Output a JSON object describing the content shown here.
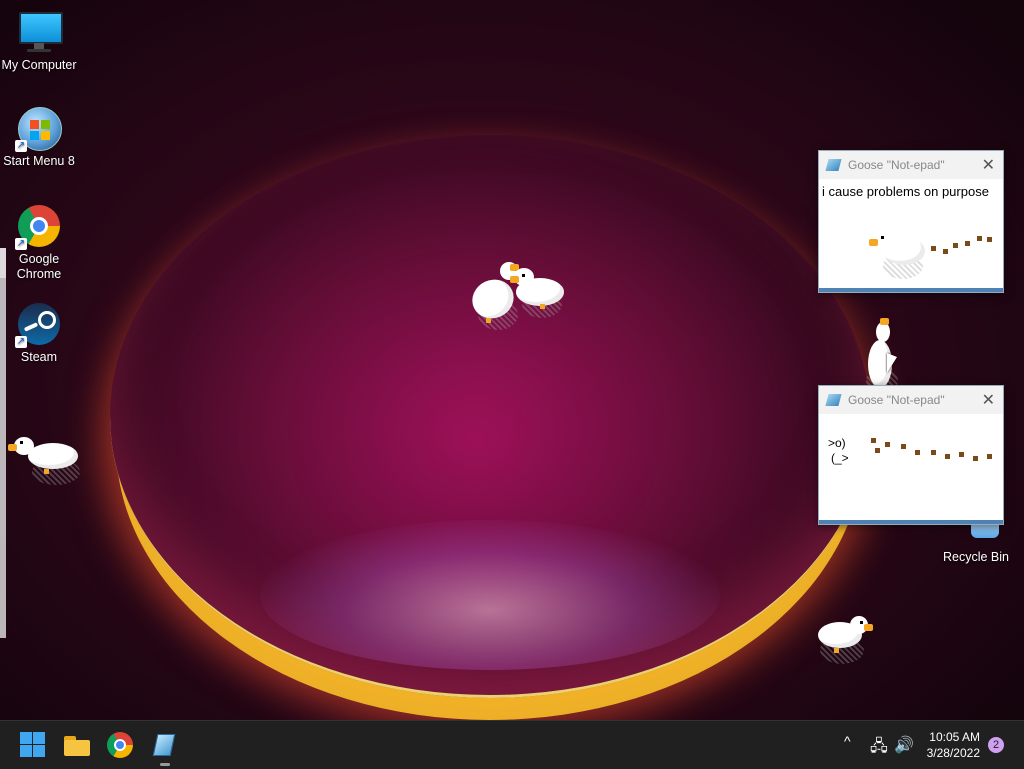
{
  "desktop": {
    "icons": [
      {
        "label": "My Computer"
      },
      {
        "label": "Start Menu 8"
      },
      {
        "label": "Google Chrome"
      },
      {
        "label": "Steam"
      },
      {
        "label": "Recycle Bin"
      }
    ]
  },
  "notepad_windows": [
    {
      "title": "Goose \"Not-epad\"",
      "text": "i cause problems on purpose"
    },
    {
      "title": "Goose \"Not-epad\"",
      "text_line1": ">o)",
      "text_line2": "(_>"
    }
  ],
  "close_glyph": "✕",
  "taskbar": {
    "apps": [
      "windows-start",
      "file-explorer",
      "google-chrome",
      "notepad"
    ],
    "tray_chevron": "^",
    "time": "10:05 AM",
    "date": "3/28/2022",
    "notification_count": "2"
  },
  "colors": {
    "taskbar_bg": "#202020",
    "accent": "#3ea7f0",
    "goose_beak": "#f5a623",
    "mud": "#7a4a18"
  }
}
